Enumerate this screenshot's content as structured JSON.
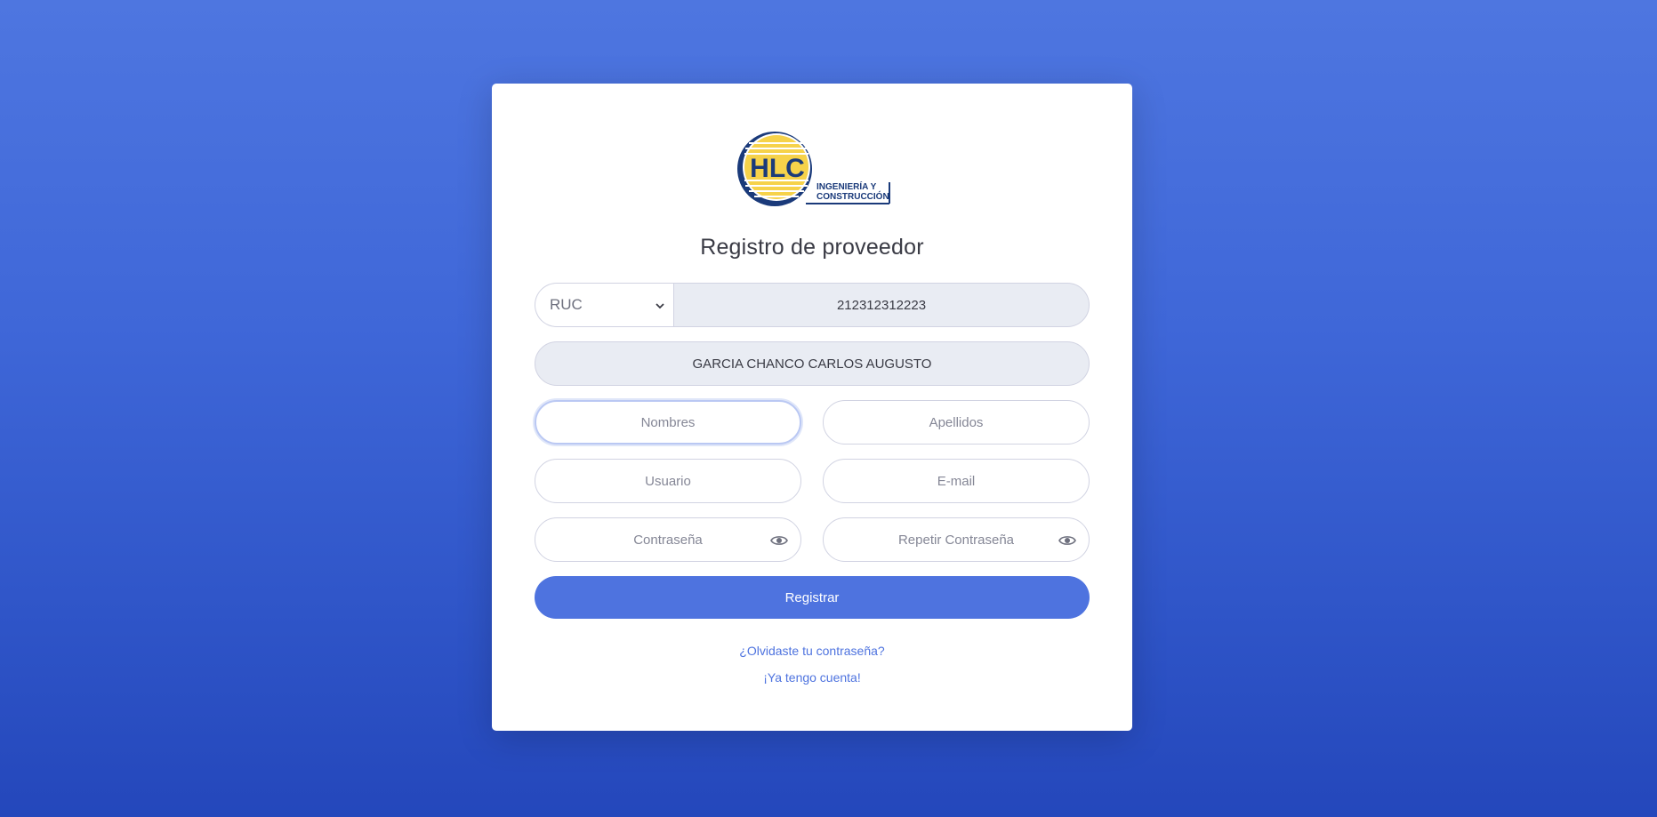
{
  "page": {
    "title": "Registro de proveedor"
  },
  "logo": {
    "initials": "HLC",
    "line1": "INGENIERÍA Y",
    "line2": "CONSTRUCCIÓN",
    "colors": {
      "navy": "#1a3a7a",
      "gold": "#e3b51c"
    }
  },
  "document": {
    "type_selected": "RUC",
    "number": "212312312223"
  },
  "razon_social": "GARCIA CHANCO CARLOS AUGUSTO",
  "fields": {
    "nombres_placeholder": "Nombres",
    "apellidos_placeholder": "Apellidos",
    "usuario_placeholder": "Usuario",
    "email_placeholder": "E-mail",
    "password_placeholder": "Contraseña",
    "repeat_password_placeholder": "Repetir Contraseña"
  },
  "actions": {
    "register_label": "Registrar",
    "forgot_password": "¿Olvidaste tu contraseña?",
    "have_account": "¡Ya tengo cuenta!"
  },
  "colors": {
    "primary": "#4e73df",
    "background_top": "#4e76e0",
    "background_bottom": "#2447bb"
  }
}
